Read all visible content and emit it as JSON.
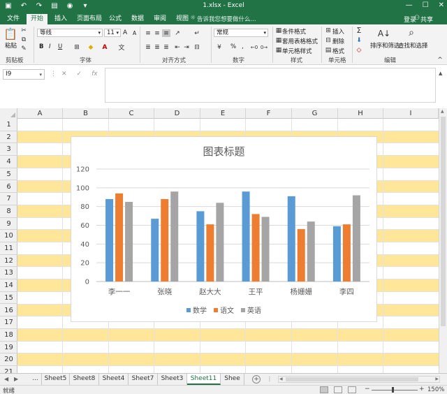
{
  "window": {
    "title": "1.xlsx - Excel",
    "qat_icons": [
      "save-icon",
      "undo-icon",
      "redo-icon",
      "print-preview-icon",
      "camera-icon",
      "customize-icon"
    ],
    "controls": [
      "minimize-icon",
      "maximize-icon",
      "close-icon"
    ]
  },
  "tabs": [
    {
      "label": "文件",
      "active": false
    },
    {
      "label": "开始",
      "active": true
    },
    {
      "label": "插入",
      "active": false
    },
    {
      "label": "页面布局",
      "active": false
    },
    {
      "label": "公式",
      "active": false
    },
    {
      "label": "数据",
      "active": false
    },
    {
      "label": "审阅",
      "active": false
    },
    {
      "label": "视图",
      "active": false
    }
  ],
  "tell_me": "告诉我您想要做什么...",
  "login": "登录",
  "share": "共享",
  "ribbon": {
    "clipboard": {
      "paste": "粘贴",
      "label": "剪贴板"
    },
    "font": {
      "name": "等线",
      "size": "11",
      "bold": "B",
      "italic": "I",
      "underline": "U",
      "grow": "A",
      "shrink": "A",
      "label": "字体"
    },
    "alignment": {
      "label": "对齐方式"
    },
    "number": {
      "format": "常规",
      "percent": "%",
      "comma": ",",
      "label": "数字"
    },
    "styles": {
      "conditional": "条件格式",
      "table": "套用表格格式",
      "cell_styles": "单元格样式",
      "label": "样式"
    },
    "cells": {
      "insert": "插入",
      "delete": "删除",
      "format": "格式",
      "label": "单元格"
    },
    "editing": {
      "sort": "排序和筛选",
      "find": "查找和选择",
      "label": "编辑"
    }
  },
  "formula_bar": {
    "name_box": "I9",
    "formula": ""
  },
  "columns": [
    "A",
    "B",
    "C",
    "D",
    "E",
    "F",
    "G",
    "H",
    "I"
  ],
  "rows": [
    "1",
    "2",
    "3",
    "4",
    "5",
    "6",
    "7",
    "8",
    "9",
    "10",
    "11",
    "12",
    "13",
    "14",
    "15",
    "16",
    "17",
    "18",
    "19",
    "20",
    "21"
  ],
  "band_color": "#ffe699",
  "chart_data": {
    "type": "bar",
    "title": "图表标题",
    "categories": [
      "李一一",
      "张晓",
      "赵大大",
      "王平",
      "杨姗姗",
      "李四"
    ],
    "series": [
      {
        "name": "数学",
        "color": "#5b9bd5",
        "values": [
          88,
          67,
          75,
          96,
          91,
          59
        ]
      },
      {
        "name": "语文",
        "color": "#ed7d31",
        "values": [
          94,
          88,
          61,
          72,
          56,
          61
        ]
      },
      {
        "name": "英语",
        "color": "#a5a5a5",
        "values": [
          85,
          96,
          84,
          69,
          64,
          92
        ]
      }
    ],
    "ylim": [
      0,
      120
    ],
    "yticks": [
      "0",
      "20",
      "40",
      "60",
      "80",
      "100",
      "120"
    ],
    "grid": true,
    "legend": "bottom"
  },
  "sheets": [
    {
      "label": "...",
      "active": false
    },
    {
      "label": "Sheet5",
      "active": false
    },
    {
      "label": "Sheet8",
      "active": false
    },
    {
      "label": "Sheet4",
      "active": false
    },
    {
      "label": "Sheet7",
      "active": false
    },
    {
      "label": "Sheet3",
      "active": false
    },
    {
      "label": "Sheet11",
      "active": true
    },
    {
      "label": "Shee",
      "active": false
    }
  ],
  "status": {
    "ready": "就绪",
    "zoom": "150%"
  }
}
